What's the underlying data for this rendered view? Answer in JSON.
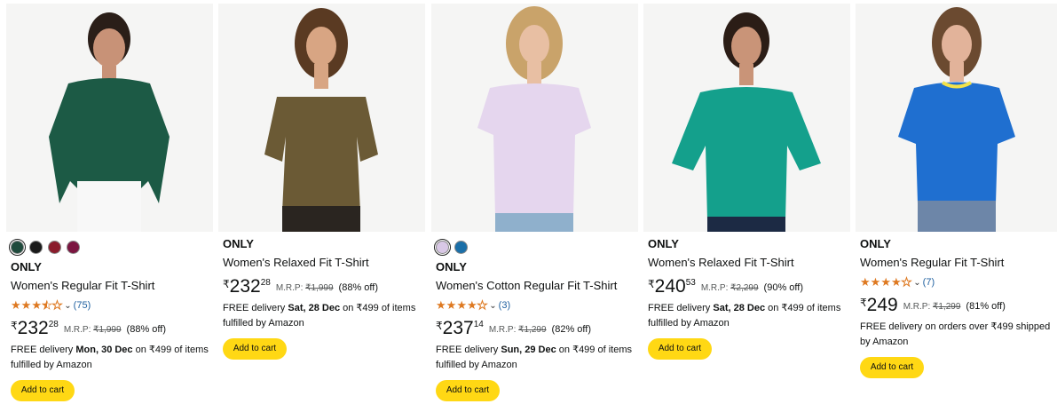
{
  "products": [
    {
      "brand": "ONLY",
      "title": "Women's Regular Fit T-Shirt",
      "swatch_colors": [
        "#1f4a3c",
        "#1a1a1a",
        "#8a1c2c",
        "#7b1540"
      ],
      "rating_value": 3.5,
      "rating_count": "(75)",
      "currency": "₹",
      "price_whole": "232",
      "price_fraction": "28",
      "mrp_label": "M.R.P:",
      "mrp": "₹1,999",
      "discount": "(88% off)",
      "delivery_prefix": "FREE delivery ",
      "delivery_date": "Mon, 30 Dec",
      "delivery_suffix": " on ₹499 of items fulfilled by Amazon",
      "cart_label": "Add to cart",
      "shirt_color": "#1c5a45"
    },
    {
      "brand": "ONLY",
      "title": "Women's Relaxed Fit T-Shirt",
      "swatch_colors": [],
      "currency": "₹",
      "price_whole": "232",
      "price_fraction": "28",
      "mrp_label": "M.R.P:",
      "mrp": "₹1,999",
      "discount": "(88% off)",
      "delivery_prefix": "FREE delivery ",
      "delivery_date": "Sat, 28 Dec",
      "delivery_suffix": " on ₹499 of items fulfilled by Amazon",
      "cart_label": "Add to cart",
      "shirt_color": "#6b5a35"
    },
    {
      "brand": "ONLY",
      "title": "Women's Cotton Regular Fit T-Shirt",
      "swatch_colors": [
        "#d9c8e6",
        "#1b6fa8"
      ],
      "rating_value": 4,
      "rating_count": "(3)",
      "currency": "₹",
      "price_whole": "237",
      "price_fraction": "14",
      "mrp_label": "M.R.P:",
      "mrp": "₹1,299",
      "discount": "(82% off)",
      "delivery_prefix": "FREE delivery ",
      "delivery_date": "Sun, 29 Dec",
      "delivery_suffix": " on ₹499 of items fulfilled by Amazon",
      "cart_label": "Add to cart",
      "shirt_color": "#e5d6ee"
    },
    {
      "brand": "ONLY",
      "title": "Women's Relaxed Fit T-Shirt",
      "swatch_colors": [],
      "currency": "₹",
      "price_whole": "240",
      "price_fraction": "53",
      "mrp_label": "M.R.P:",
      "mrp": "₹2,299",
      "discount": "(90% off)",
      "delivery_prefix": "FREE delivery ",
      "delivery_date": "Sat, 28 Dec",
      "delivery_suffix": " on ₹499 of items fulfilled by Amazon",
      "cart_label": "Add to cart",
      "shirt_color": "#14a08c"
    },
    {
      "brand": "ONLY",
      "title": "Women's Regular Fit T-Shirt",
      "swatch_colors": [],
      "rating_value": 4,
      "rating_count": "(7)",
      "currency": "₹",
      "price_whole": "249",
      "price_fraction": "",
      "mrp_label": "M.R.P:",
      "mrp": "₹1,299",
      "discount": "(81% off)",
      "delivery_prefix": "FREE delivery on orders over ₹499 shipped by Amazon",
      "delivery_date": "",
      "delivery_suffix": "",
      "cart_label": "Add to cart",
      "shirt_color": "#1f6fd0"
    }
  ],
  "colors": {
    "star": "#de7921",
    "link": "#2162a1",
    "cart_button": "#ffd814"
  },
  "icons": {
    "star": "star-icon",
    "chevron": "chevron-down-icon"
  }
}
